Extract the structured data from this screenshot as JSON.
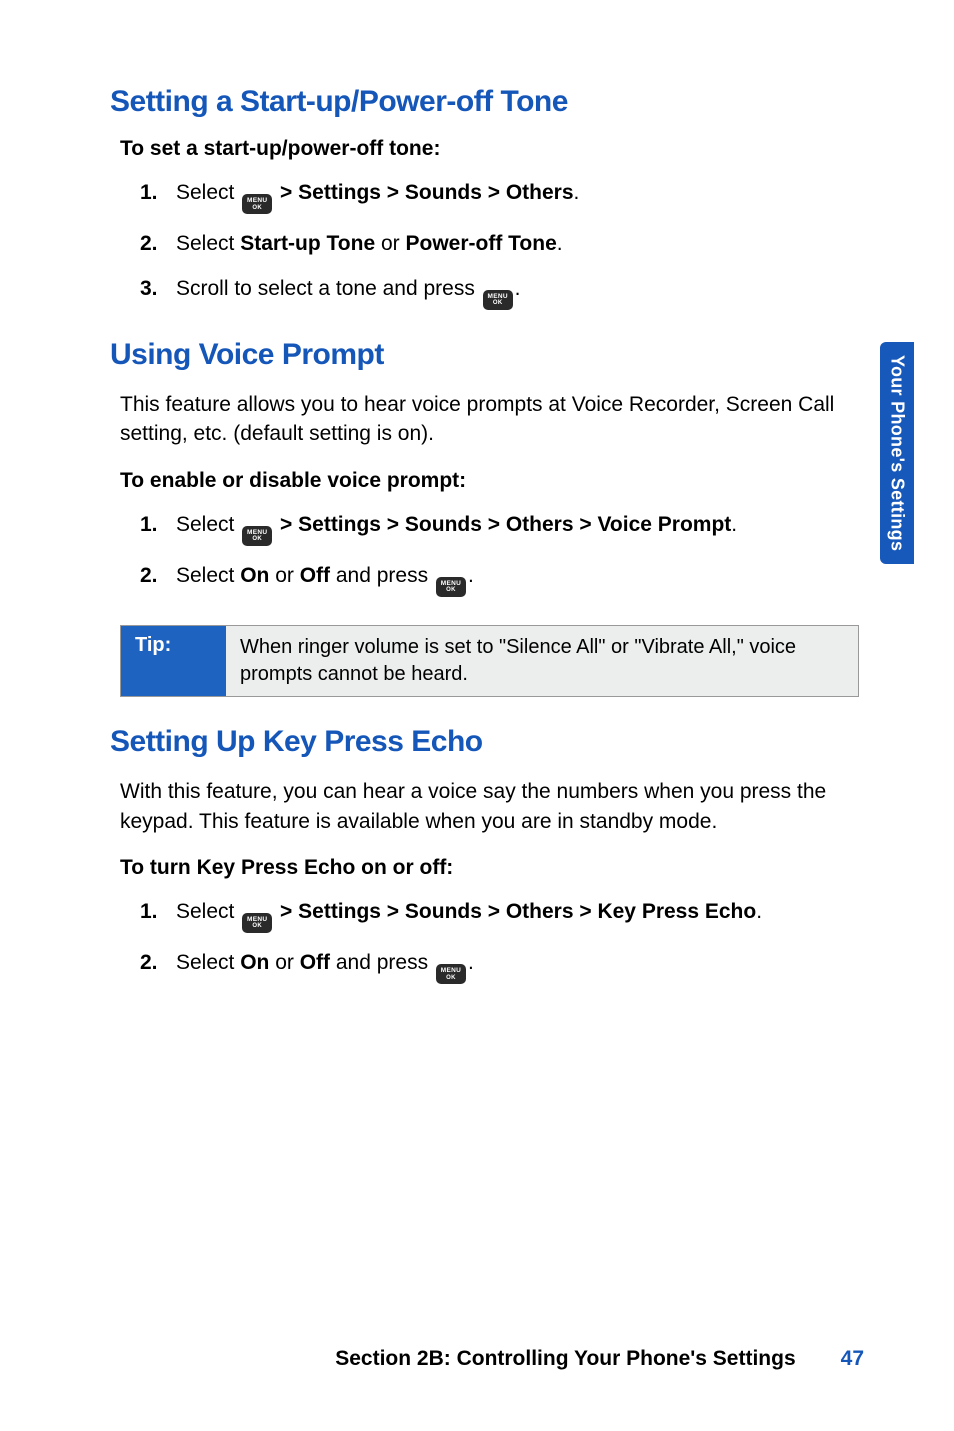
{
  "side_tab": "Your Phone's Settings",
  "section1": {
    "heading": "Setting a Start-up/Power-off Tone",
    "sub": "To set a start-up/power-off tone:",
    "steps": [
      {
        "n": "1.",
        "pre": "Select ",
        "icon": true,
        "path": " > Settings > Sounds > Others",
        "post": "."
      },
      {
        "n": "2.",
        "pre": "Select ",
        "b1": "Start-up Tone",
        "mid": " or ",
        "b2": "Power-off Tone",
        "post": "."
      },
      {
        "n": "3.",
        "pre": "Scroll to select a tone and press ",
        "icon_end": true,
        "post": "."
      }
    ]
  },
  "section2": {
    "heading": "Using Voice Prompt",
    "intro": "This feature allows you to hear voice prompts at Voice Recorder, Screen Call setting, etc. (default setting is on).",
    "sub": "To enable or disable voice prompt:",
    "steps": [
      {
        "n": "1.",
        "pre": "Select ",
        "icon": true,
        "path": " > Settings > Sounds > Others > Voice Prompt",
        "post": "."
      },
      {
        "n": "2.",
        "pre": "Select ",
        "b1": "On",
        "mid": " or ",
        "b2": "Off",
        "post_pre": " and press ",
        "icon_end": true,
        "post": "."
      }
    ],
    "tip_label": "Tip:",
    "tip_text": "When ringer volume is set to \"Silence All\" or \"Vibrate All,\" voice prompts cannot be heard."
  },
  "section3": {
    "heading": "Setting Up Key Press Echo",
    "intro": "With this feature, you can hear a voice say the numbers when you press the keypad. This feature is available when you are in standby mode.",
    "sub": "To turn Key Press Echo on or off:",
    "steps": [
      {
        "n": "1.",
        "pre": "Select ",
        "icon": true,
        "path": " > Settings > Sounds > Others > Key Press Echo",
        "post": "."
      },
      {
        "n": "2.",
        "pre": "Select ",
        "b1": "On",
        "mid": " or ",
        "b2": "Off",
        "post_pre": " and press ",
        "icon_end": true,
        "post": "."
      }
    ]
  },
  "footer": {
    "text": "Section 2B: Controlling Your Phone's Settings",
    "page": "47"
  },
  "icon": {
    "top": "MENU",
    "bot": "OK"
  }
}
